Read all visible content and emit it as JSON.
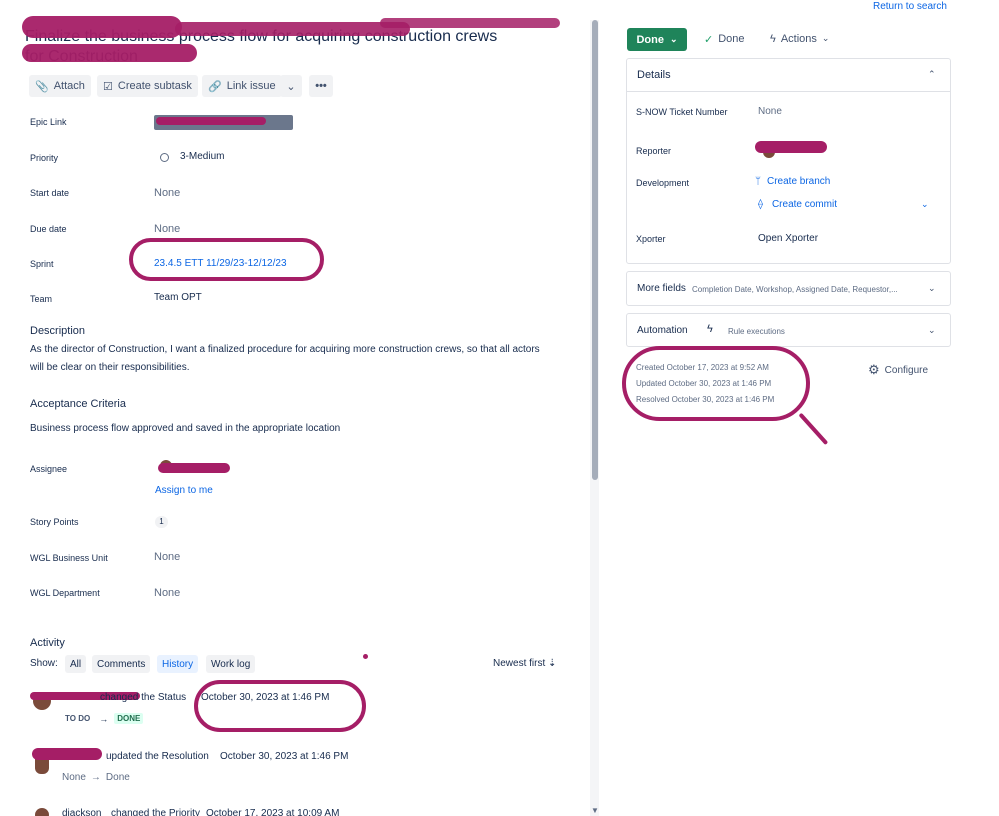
{
  "top_link": "Return to search",
  "issue": {
    "title_line1": "Finalize the business process flow for acquiring construction crews",
    "title_line2": "for Construction"
  },
  "toolbar": {
    "attach": "Attach",
    "create_subtask": "Create subtask",
    "link_issue": "Link issue"
  },
  "fields": {
    "epic_link_label": "Epic Link",
    "epic_link_value": "",
    "priority_label": "Priority",
    "priority_value": "3-Medium",
    "start_date_label": "Start date",
    "start_date_value": "None",
    "due_date_label": "Due date",
    "due_date_value": "None",
    "sprint_label": "Sprint",
    "sprint_value": "23.4.5 ETT 11/29/23-12/12/23",
    "team_label": "Team",
    "team_value": "Team OPT"
  },
  "description": {
    "heading": "Description",
    "line1": "As the director of Construction, I want a finalized procedure for acquiring more construction crews, so that all actors",
    "line2": "will be clear on their responsibilities."
  },
  "acceptance": {
    "heading": "Acceptance Criteria",
    "text": "Business process flow approved and saved in the appropriate location"
  },
  "people": {
    "assignee_label": "Assignee",
    "assign_to_me": "Assign to me",
    "story_points_label": "Story Points",
    "story_points_value": "1",
    "wgl_bu_label": "WGL Business Unit",
    "wgl_bu_value": "None",
    "wgl_dept_label": "WGL Department",
    "wgl_dept_value": "None"
  },
  "activity": {
    "heading": "Activity",
    "show_label": "Show:",
    "tabs": [
      "All",
      "Comments",
      "History",
      "Work log"
    ],
    "sort_label": "Newest first",
    "entries": [
      {
        "action": "changed the Status",
        "time": "October 30, 2023 at 1:46 PM",
        "from": "TO DO",
        "arrow": "→",
        "to": "DONE"
      },
      {
        "action": "updated the Resolution",
        "time": "October 30, 2023 at 1:46 PM",
        "from": "None",
        "arrow": "→",
        "to": "Done"
      },
      {
        "user": "djackson",
        "action": "changed the Priority",
        "time": "October 17, 2023 at 10:09 AM"
      }
    ]
  },
  "right": {
    "status_button": "Done",
    "resolution": "Done",
    "actions": "Actions",
    "details_heading": "Details",
    "snow_label": "S-NOW Ticket Number",
    "snow_value": "None",
    "reporter_label": "Reporter",
    "development_label": "Development",
    "create_branch": "Create branch",
    "create_commit": "Create commit",
    "xporter_label": "Xporter",
    "xporter_value": "Open Xporter",
    "more_fields_heading": "More fields",
    "more_fields_sub": "Completion Date, Workshop, Assigned Date, Requestor,...",
    "automation_heading": "Automation",
    "automation_sub": "Rule executions",
    "created": "Created October 17, 2023 at 9:52 AM",
    "updated": "Updated October 30, 2023 at 1:46 PM",
    "resolved": "Resolved October 30, 2023 at 1:46 PM",
    "configure": "Configure"
  },
  "colors": {
    "accent": "#0c66e4",
    "done_green": "#1f845a",
    "annotation": "#a51e66"
  }
}
